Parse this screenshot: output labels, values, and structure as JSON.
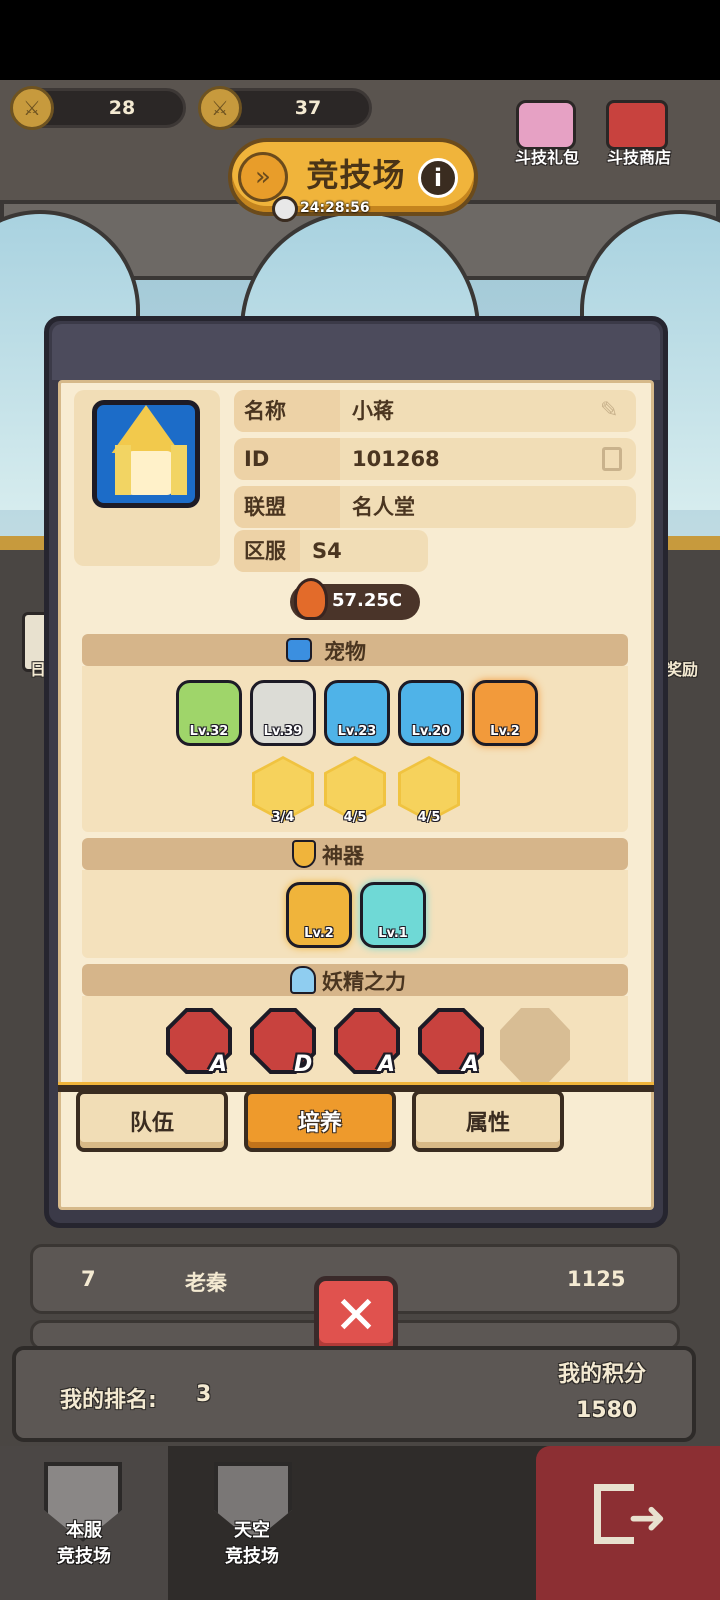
{
  "currency": [
    {
      "icon": "arena-medal-icon",
      "value": "28"
    },
    {
      "icon": "arena-ticket-icon",
      "value": "37"
    }
  ],
  "header": {
    "title": "竞技场",
    "timer": "24:28:56",
    "gift_label": "斗技礼包",
    "shop_label": "斗技商店"
  },
  "player": {
    "name_label": "名称",
    "name": "小蒋",
    "id_label": "ID",
    "id": "101268",
    "alliance_label": "联盟",
    "alliance": "名人堂",
    "server_label": "区服",
    "server": "S4",
    "power": "57.25C"
  },
  "sections": {
    "pets_title": "宠物",
    "artifacts_title": "神器",
    "fairy_title": "妖精之力"
  },
  "pets": [
    {
      "level": "Lv.32",
      "color": "#9fd56a"
    },
    {
      "level": "Lv.39",
      "color": "#dcdcd6"
    },
    {
      "level": "Lv.23",
      "color": "#4fb3e8"
    },
    {
      "level": "Lv.20",
      "color": "#4fb3e8"
    },
    {
      "level": "Lv.2",
      "color": "#f29a3b"
    }
  ],
  "pet_shards": [
    {
      "progress": "3/4"
    },
    {
      "progress": "4/5"
    },
    {
      "progress": "4/5"
    }
  ],
  "artifacts": [
    {
      "level": "Lv.2",
      "color": "#f0b43b"
    },
    {
      "level": "Lv.1",
      "color": "#6fd9d6"
    }
  ],
  "fairy": [
    {
      "icon": "lightning-heart-icon",
      "grade": "A"
    },
    {
      "icon": "heart-plus-icon",
      "grade": "D"
    },
    {
      "icon": "percent-burst-icon",
      "grade": "A"
    },
    {
      "icon": "sword-ghost-icon",
      "grade": "A"
    }
  ],
  "tabs": {
    "team": "队伍",
    "train": "培养",
    "attributes": "属性"
  },
  "ranking_row": {
    "rank": "7",
    "name": "老秦",
    "score": "1125"
  },
  "my_rank": {
    "rank_label": "我的排名:",
    "rank_value": "3",
    "score_label": "我的积分",
    "score_value": "1580"
  },
  "bottom_nav": {
    "local_line1": "本服",
    "local_line2": "竞技场",
    "sky_line1": "天空",
    "sky_line2": "竞技场"
  },
  "side_labels": {
    "left": "日",
    "right": "奖励"
  }
}
